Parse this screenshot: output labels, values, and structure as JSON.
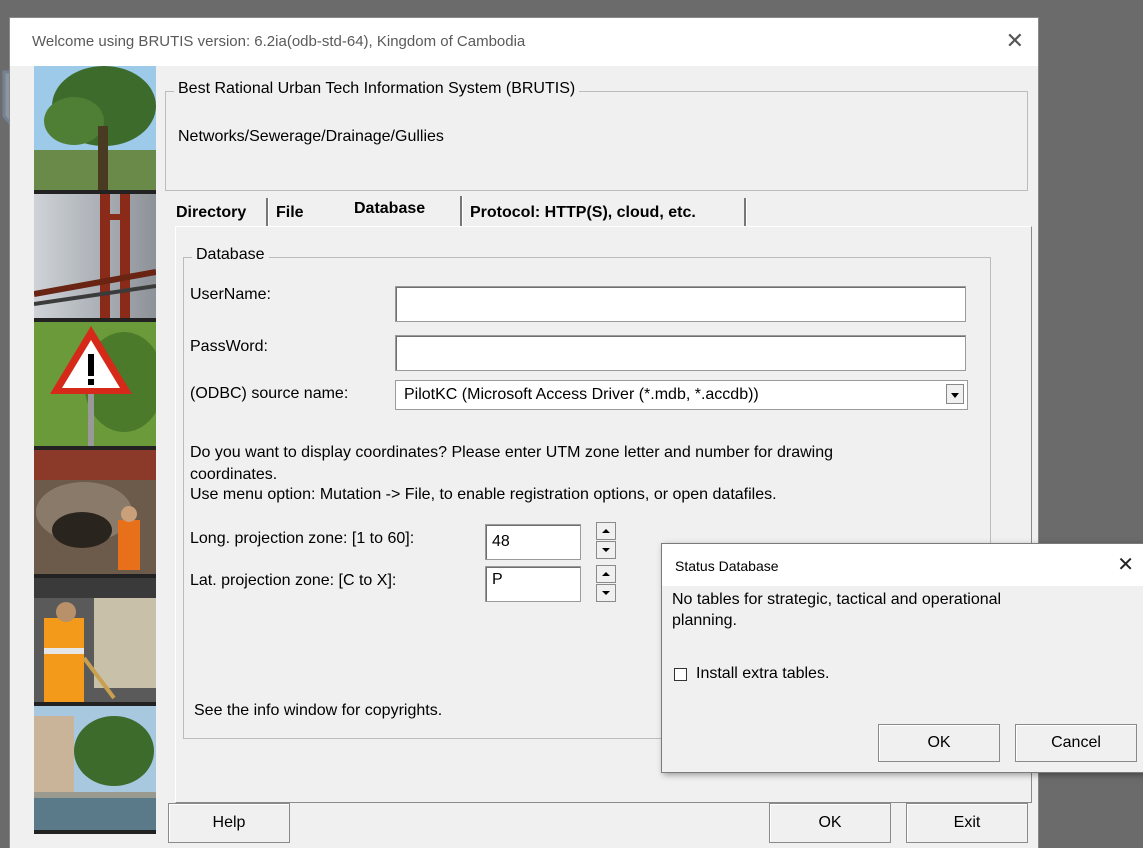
{
  "window": {
    "title": "Welcome using BRUTIS version: 6.2ia(odb-std-64), Kingdom of Cambodia",
    "close_glyph": "✕"
  },
  "header_group": {
    "title": "Best Rational Urban Tech Information System (BRUTIS)",
    "subtitle": "Networks/Sewerage/Drainage/Gullies"
  },
  "tabs": [
    {
      "label": "Directory"
    },
    {
      "label": "File"
    },
    {
      "label": "Database",
      "active": true
    },
    {
      "label": "Protocol: HTTP(S), cloud, etc."
    }
  ],
  "database_group": {
    "title": "Database",
    "username_label": "UserName:",
    "username_value": "",
    "password_label": "PassWord:",
    "password_value": "",
    "odbc_label": "(ODBC) source name:",
    "odbc_value": "PilotKC (Microsoft Access Driver (*.mdb, *.accdb))",
    "coord_text_1": "Do you want to display coordinates?  Please enter UTM zone letter and number for drawing",
    "coord_text_2": "coordinates.",
    "coord_text_3": "Use menu option: Mutation -> File, to enable registration options, or open datafiles.",
    "long_label": "Long. projection zone: [1 to 60]:",
    "long_value": "48",
    "lat_label": "Lat. projection zone: [C to X]:",
    "lat_value": "P",
    "copyright_text": "See the info window for copyrights."
  },
  "bottom_buttons": {
    "help": "Help",
    "ok": "OK",
    "exit": "Exit"
  },
  "status_dialog": {
    "title": "Status Database",
    "close_glyph": "✕",
    "message_1": "No tables for strategic, tactical and operational",
    "message_2": "planning.",
    "checkbox_label": "Install extra tables.",
    "checkbox_checked": false,
    "ok": "OK",
    "cancel": "Cancel"
  },
  "side_images": [
    {
      "icon": "tree-photo-icon"
    },
    {
      "icon": "bridge-photo-icon"
    },
    {
      "icon": "warning-sign-photo-icon"
    },
    {
      "icon": "sewer-worker-photo-icon"
    },
    {
      "icon": "road-worker-photo-icon"
    },
    {
      "icon": "canal-photo-icon"
    }
  ],
  "colors": {
    "dialog_bg": "#f0f0f0",
    "desktop_bg": "#6b6b6b",
    "title_bar": "#ffffff"
  }
}
